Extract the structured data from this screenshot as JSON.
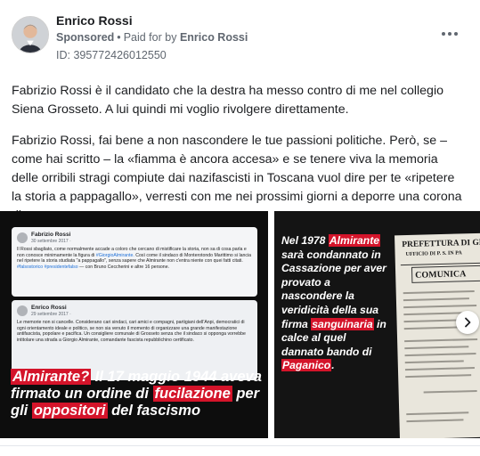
{
  "ad": {
    "author": "Enrico Rossi",
    "sponsored_label": "Sponsored",
    "paid_for_prefix": "Paid for by",
    "paid_for_name": "Enrico Rossi",
    "id_text": "ID: 395772426012550"
  },
  "post": {
    "paragraph1": "Fabrizio Rossi è il candidato che la destra ha messo contro di me nel collegio Siena Grosseto. A lui quindi mi voglio rivolgere direttamente.",
    "paragraph2": "Fabrizio Rossi, fai bene a non nascondere le tue passioni politiche. Però, se – come hai scritto – la «fiamma è ancora accesa» e se tenere viva la memoria delle orribili stragi compiute dai nazifascisti in Toscana vuol dire per te «ripetere la storia a pappagallo», verresti con me nei prossimi giorni a deporre una corona di..."
  },
  "slide1": {
    "tweet1": {
      "name": "Fabrizio Rossi",
      "date": "30 settembre 2017 ·",
      "body": "Il Rossi sbagliato, come normalmente accade a coloro che cercano di mistificare la storia, non sa di cosa parla e non conosce minimamente la figura di",
      "hashtag1": "#GiorgioAlmirante.",
      "body2": "Così come il sindaco di Monterotondo Marittimo si lancia nel ripetere la storia studiata \"a pappagallo\", senza sapere che Almirante non c'entra niente con quei fatti citati.",
      "hashtag2": "#falsostorico #presidentefalso",
      "body3": "— con Bruno Ceccherini e altre 16 persone."
    },
    "tweet2": {
      "name": "Enrico Rossi",
      "date": "29 settembre 2017 ·",
      "body": "Le memorie non si cancelle. Considerano cari sindaci, cari amici e compagni, partigiani dell'Anpi, democratici di ogni orientamento ideale e politico, se non sia venuto il momento di organizzare una grande manifestazione antifascista, popolare e pacifica. Un consigliere comunale di Grosseto senza che il sindaco si opponga vorrebbe intitolare una strada a Giorgio Almirante, comandante fascista repubblichino certificato."
    },
    "title_h1": "Almirante?",
    "title_t1": " Il 17 maggio 1944 aveva firmato un ordine di ",
    "title_h2": "fucilazione",
    "title_t2": " per gli ",
    "title_h3": "oppositori",
    "title_t3": " del fascismo"
  },
  "slide2": {
    "t1": "Nel 1978 ",
    "h1": "Almirante",
    "t2": " sarà condannato in Cassazione per aver provato a nascondere la veridicità della sua firma ",
    "h2": "sanguinaria",
    "t3": " in calce al quel dannato bando di ",
    "h3": "Paganico",
    "t4": ".",
    "doc_line1": "PREFETTURA DI GR",
    "doc_line2": "UFFICIO DI P. S. IN PA",
    "doc_line3": "COMUNICA"
  },
  "icons": {
    "more": "more-horizontal-icon",
    "next": "chevron-right-icon"
  }
}
